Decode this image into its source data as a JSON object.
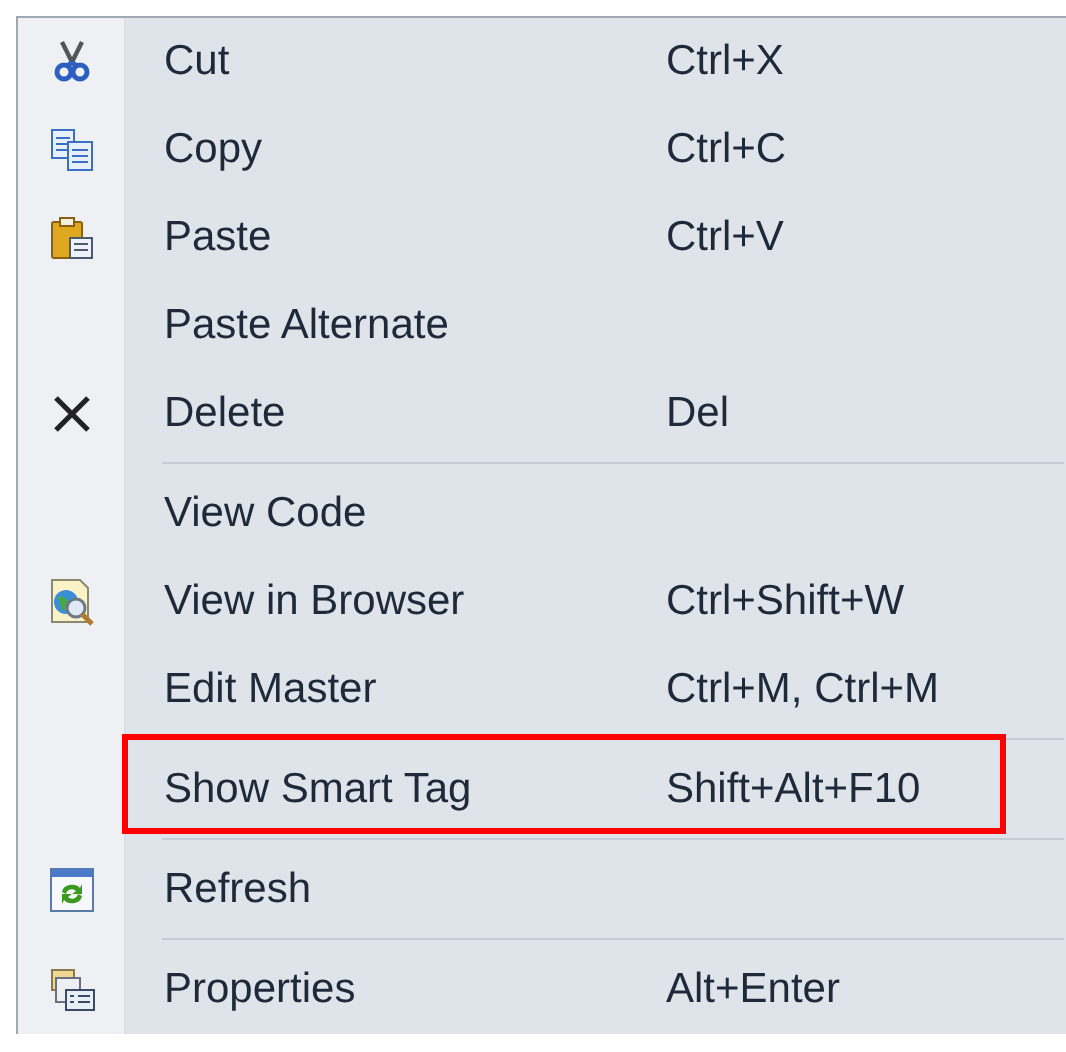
{
  "menu": {
    "items": [
      {
        "kind": "item",
        "label": "Cut",
        "shortcut": "Ctrl+X",
        "highlighted": false
      },
      {
        "kind": "item",
        "label": "Copy",
        "shortcut": "Ctrl+C",
        "highlighted": false
      },
      {
        "kind": "item",
        "label": "Paste",
        "shortcut": "Ctrl+V",
        "highlighted": false
      },
      {
        "kind": "item",
        "label": "Paste Alternate",
        "highlighted": false
      },
      {
        "kind": "item",
        "label": "Delete",
        "shortcut": "Del",
        "highlighted": false
      },
      {
        "kind": "separator"
      },
      {
        "kind": "item",
        "label": "View Code",
        "highlighted": false
      },
      {
        "kind": "item",
        "label": "View in Browser",
        "shortcut": "Ctrl+Shift+W",
        "highlighted": false
      },
      {
        "kind": "item",
        "label": "Edit Master",
        "shortcut": "Ctrl+M, Ctrl+M",
        "highlighted": false
      },
      {
        "kind": "separator"
      },
      {
        "kind": "item",
        "label": "Show Smart Tag",
        "shortcut": "Shift+Alt+F10",
        "highlighted": true
      },
      {
        "kind": "separator"
      },
      {
        "kind": "item",
        "label": "Refresh",
        "highlighted": false
      },
      {
        "kind": "separator"
      },
      {
        "kind": "item",
        "label": "Properties",
        "shortcut": "Alt+Enter",
        "highlighted": false
      }
    ]
  }
}
